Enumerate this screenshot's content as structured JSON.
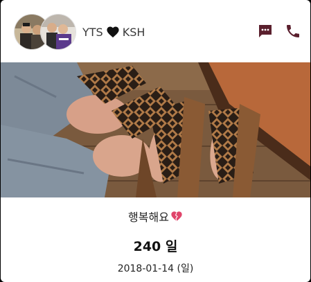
{
  "header": {
    "name_left": "YTS",
    "name_right": "KSH",
    "heart_icon": "heart-icon",
    "message_icon": "message-icon",
    "call_icon": "phone-icon"
  },
  "photo": {
    "subject": "sandals-photo"
  },
  "caption": {
    "text": "행복해요",
    "emoji": "broken-heart-icon"
  },
  "counter": {
    "days": "240 일"
  },
  "date": {
    "value": "2018-01-14 (일)"
  },
  "colors": {
    "icon": "#5a1f2d",
    "text": "#222222",
    "emoji": "#e0456b"
  }
}
